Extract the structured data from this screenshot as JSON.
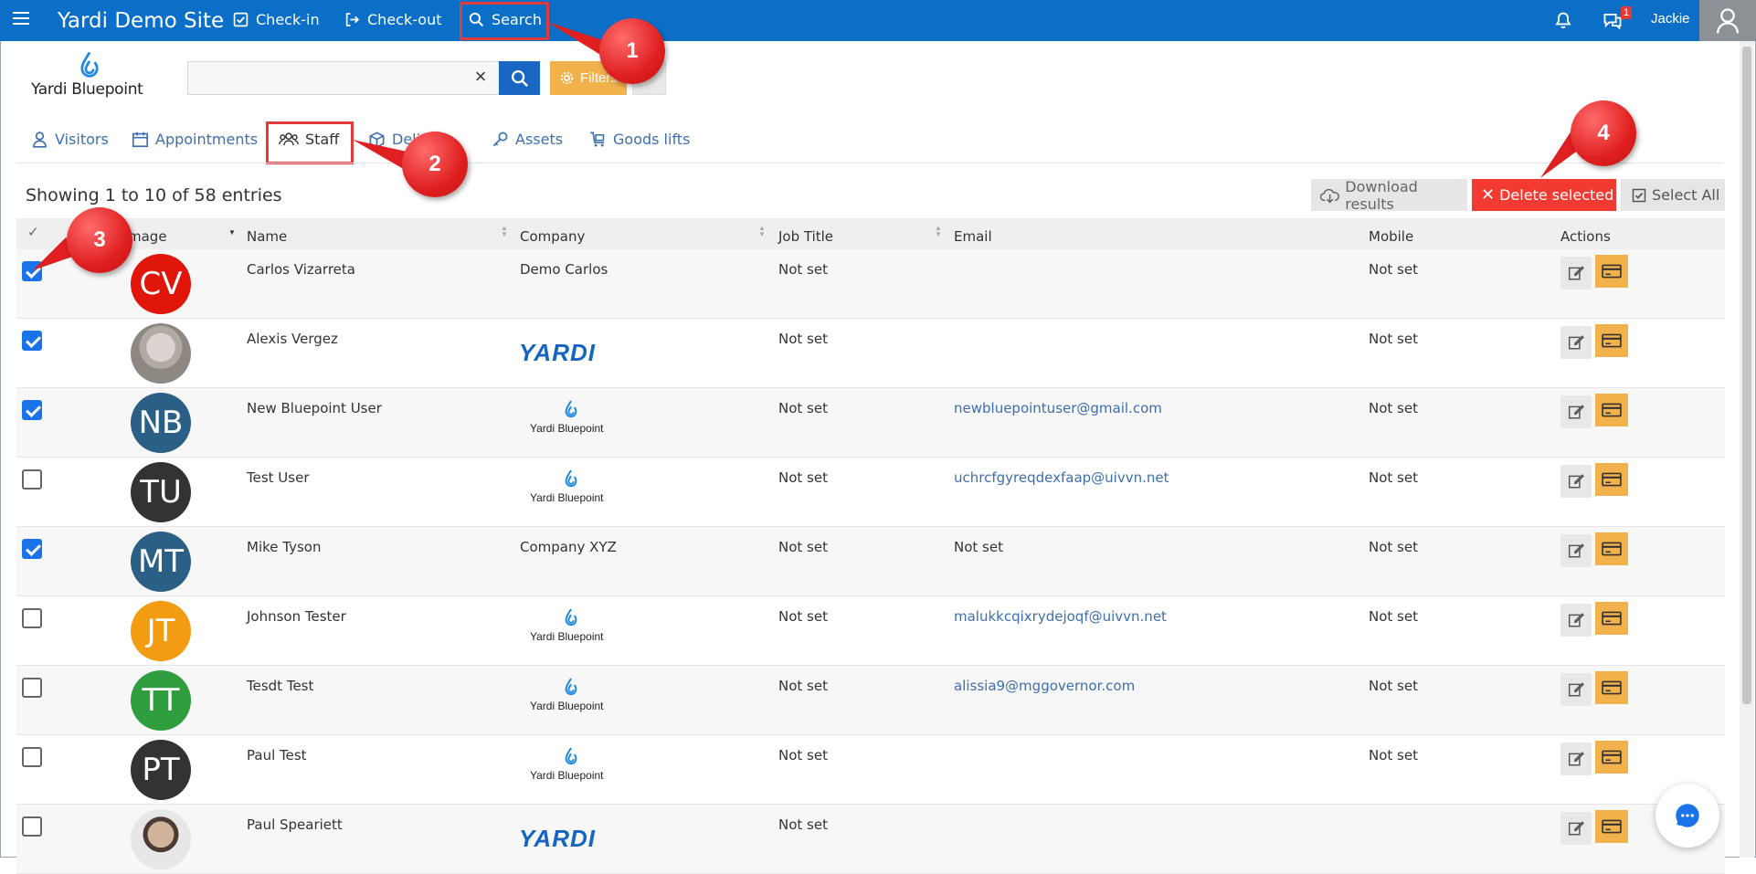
{
  "topbar": {
    "site_name": "Yardi Demo Site",
    "nav": [
      {
        "label": "Check-in",
        "icon": "checkbox-icon"
      },
      {
        "label": "Check-out",
        "icon": "logout-icon"
      },
      {
        "label": "Search",
        "icon": "search-icon"
      }
    ],
    "notification_badge": "1",
    "user_name": "Jackie"
  },
  "logo": {
    "text": "Yardi Bluepoint"
  },
  "search": {
    "value": "",
    "placeholder": "",
    "filters_label": "Filters"
  },
  "tabs": [
    {
      "label": "Visitors",
      "icon": "visitor-icon"
    },
    {
      "label": "Appointments",
      "icon": "calendar-icon"
    },
    {
      "label": "Staff",
      "icon": "staff-icon",
      "active": true
    },
    {
      "label": "Deliveries",
      "icon": "delivery-icon"
    },
    {
      "label": "Assets",
      "icon": "key-icon"
    },
    {
      "label": "Goods lifts",
      "icon": "cart-icon"
    }
  ],
  "tab_partial_label": "Deli",
  "table_info": "Showing 1 to 10 of 58 entries",
  "toolbar": {
    "download_label": "Download results",
    "delete_label": "Delete selected",
    "select_all_label": "Select All"
  },
  "columns": {
    "check": "✓",
    "image": "Image",
    "image_visible": "mage",
    "name": "Name",
    "company": "Company",
    "job_title": "Job Title",
    "email": "Email",
    "mobile": "Mobile",
    "actions": "Actions"
  },
  "rows": [
    {
      "checked": true,
      "initials": "CV",
      "avatar_color": "#e0160b",
      "name": "Carlos Vizarreta",
      "company": "Demo Carlos",
      "company_type": "text",
      "job": "Not set",
      "email": "",
      "mobile": "Not set"
    },
    {
      "checked": true,
      "initials": "",
      "avatar_color": "photo",
      "name": "Alexis Vergez",
      "company": "YARDI",
      "company_type": "yardi",
      "job": "Not set",
      "email": "",
      "mobile": "Not set"
    },
    {
      "checked": true,
      "initials": "NB",
      "avatar_color": "#2a5f86",
      "name": "New Bluepoint User",
      "company": "Yardi Bluepoint",
      "company_type": "bluepoint",
      "job": "Not set",
      "email": "newbluepointuser@gmail.com",
      "mobile": "Not set"
    },
    {
      "checked": false,
      "initials": "TU",
      "avatar_color": "#333333",
      "name": "Test User",
      "company": "Yardi Bluepoint",
      "company_type": "bluepoint",
      "job": "Not set",
      "email": "uchrcfgyreqdexfaap@uivvn.net",
      "mobile": "Not set"
    },
    {
      "checked": true,
      "initials": "MT",
      "avatar_color": "#2a5f86",
      "name": "Mike Tyson",
      "company": "Company XYZ",
      "company_type": "text",
      "job": "Not set",
      "email": "Not set",
      "mobile": "Not set"
    },
    {
      "checked": false,
      "initials": "JT",
      "avatar_color": "#f39c12",
      "name": "Johnson Tester",
      "company": "Yardi Bluepoint",
      "company_type": "bluepoint",
      "job": "Not set",
      "email": "malukkcqixrydejoqf@uivvn.net",
      "mobile": "Not set"
    },
    {
      "checked": false,
      "initials": "TT",
      "avatar_color": "#2e9e3e",
      "name": "Tesdt Test",
      "company": "Yardi Bluepoint",
      "company_type": "bluepoint",
      "job": "Not set",
      "email": "alissia9@mggovernor.com",
      "mobile": "Not set"
    },
    {
      "checked": false,
      "initials": "PT",
      "avatar_color": "#333333",
      "name": "Paul Test",
      "company": "Yardi Bluepoint",
      "company_type": "bluepoint",
      "job": "Not set",
      "email": "",
      "mobile": "Not set"
    },
    {
      "checked": false,
      "initials": "",
      "avatar_color": "photo2",
      "name": "Paul Speariett",
      "company": "YARDI",
      "company_type": "yardi",
      "job": "Not set",
      "email": "",
      "mobile": ""
    }
  ],
  "callouts": [
    "1",
    "2",
    "3",
    "4"
  ],
  "colors": {
    "primary": "#0b6fc7",
    "danger": "#f23a33",
    "warning": "#f1b24c",
    "link": "#3d6fae"
  }
}
